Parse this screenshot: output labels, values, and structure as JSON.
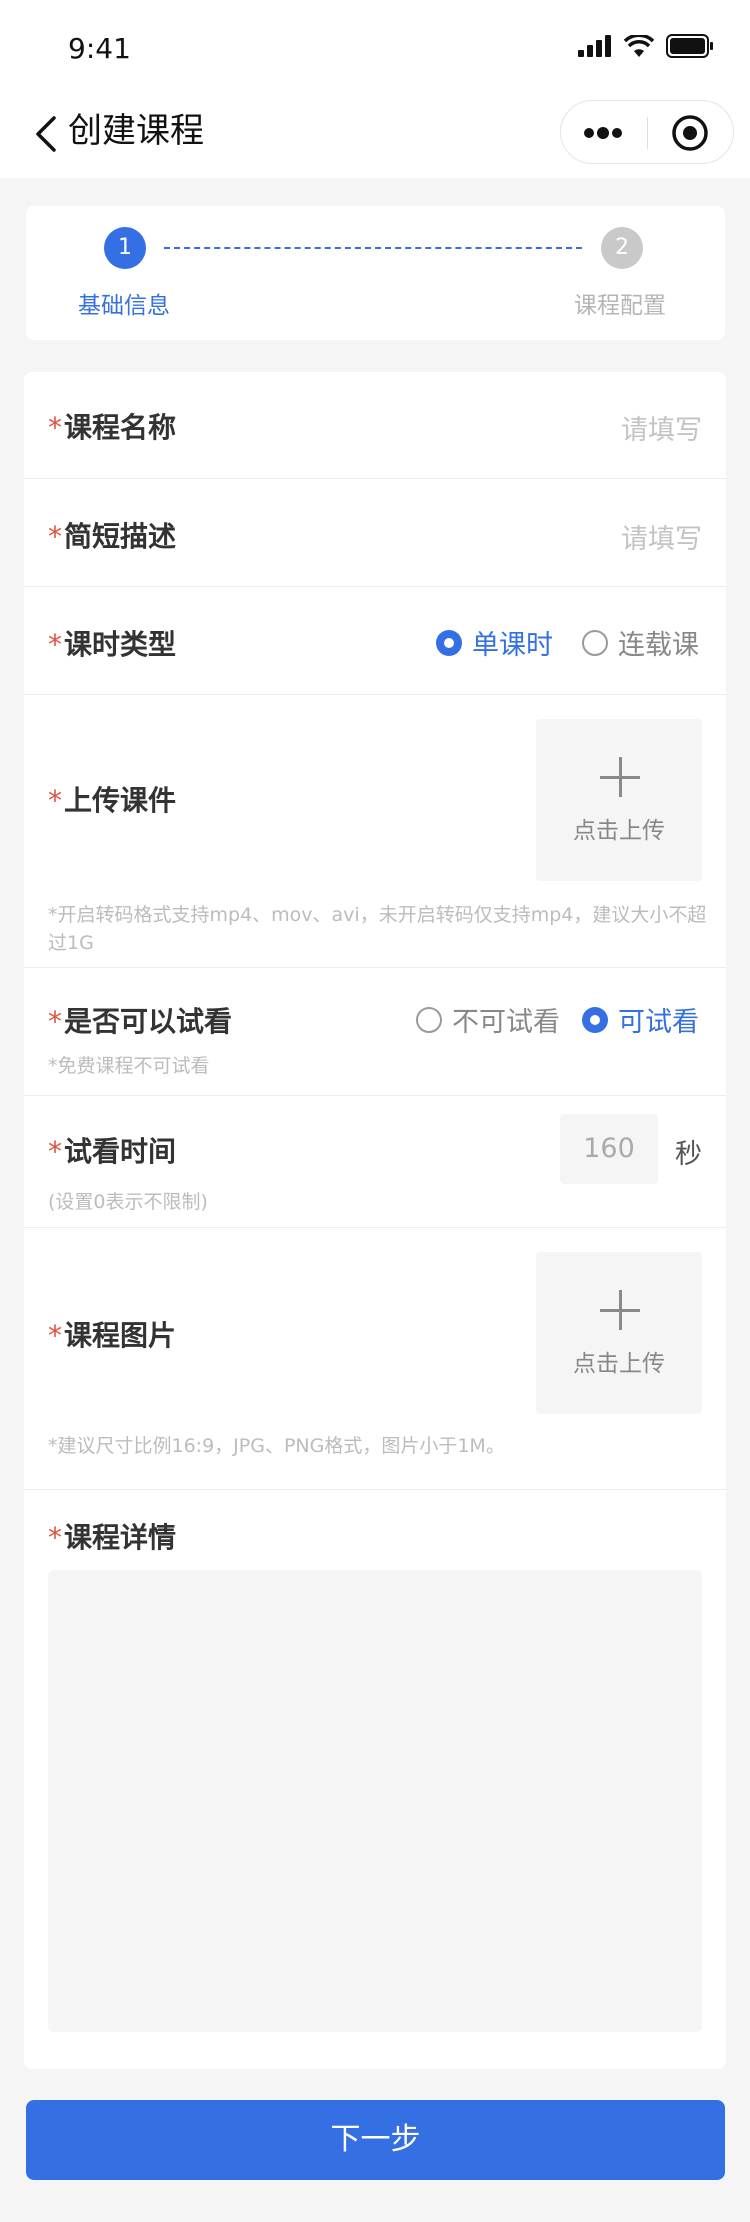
{
  "status_bar": {
    "time": "9:41"
  },
  "nav": {
    "title": "创建课程"
  },
  "steps": [
    {
      "num": "1",
      "label": "基础信息",
      "active": true
    },
    {
      "num": "2",
      "label": "课程配置",
      "active": false
    }
  ],
  "form": {
    "required_mark": "*",
    "course_name": {
      "label": "课程名称",
      "placeholder": "请填写"
    },
    "short_desc": {
      "label": "简短描述",
      "placeholder": "请填写"
    },
    "lesson_type": {
      "label": "课时类型",
      "options": [
        "单课时",
        "连载课"
      ],
      "selected": "单课时"
    },
    "courseware": {
      "label": "上传课件",
      "upload_label": "点击上传",
      "hint": "*开启转码格式支持mp4、mov、avi，未开启转码仅支持mp4，建议大小不超过1G"
    },
    "trial": {
      "label": "是否可以试看",
      "options": [
        "不可试看",
        "可试看"
      ],
      "selected": "可试看",
      "hint": "*免费课程不可试看"
    },
    "trial_time": {
      "label": "试看时间",
      "value": "160",
      "unit": "秒",
      "hint": "(设置0表示不限制)"
    },
    "course_image": {
      "label": "课程图片",
      "upload_label": "点击上传",
      "hint": "*建议尺寸比例16:9，JPG、PNG格式，图片小于1M。"
    },
    "course_detail": {
      "label": "课程详情"
    }
  },
  "next_button": {
    "label": "下一步"
  },
  "colors": {
    "primary": "#3470e4",
    "required": "#e0533f",
    "background": "#f5f5f5"
  }
}
